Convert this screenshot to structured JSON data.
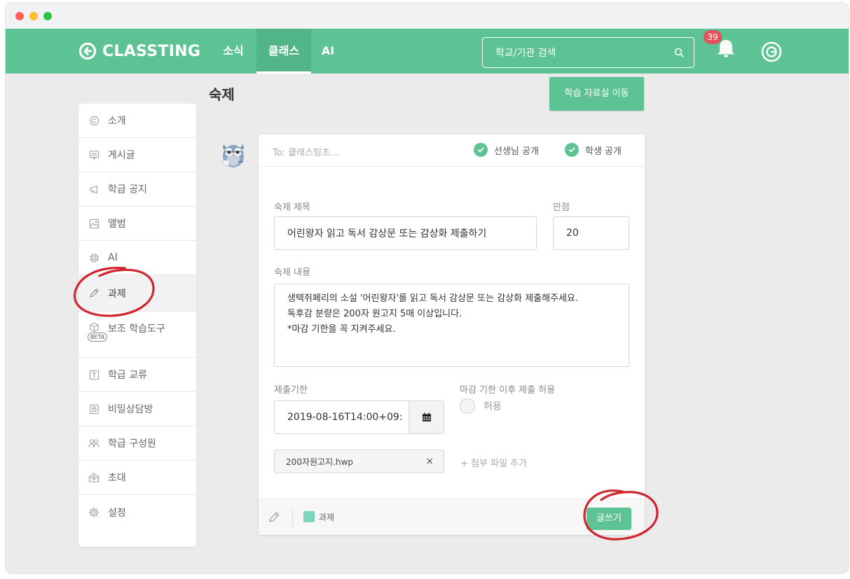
{
  "app": {
    "logo_text": "CLASSTING",
    "nav": [
      "소식",
      "클래스",
      "AI"
    ],
    "search_placeholder": "학교/기관 검색",
    "notification_count": "39"
  },
  "page": {
    "title": "숙제",
    "library_button": "학습 자료실 이동"
  },
  "sidebar": {
    "items": [
      {
        "label": "소개",
        "icon": "copyright-icon"
      },
      {
        "label": "게시글",
        "icon": "post-icon"
      },
      {
        "label": "학급 공지",
        "icon": "megaphone-icon"
      },
      {
        "label": "앨범",
        "icon": "image-icon"
      },
      {
        "label": "AI",
        "icon": "chip-icon"
      },
      {
        "label": "과제",
        "icon": "pencil-icon",
        "active": true
      },
      {
        "label": "보조 학습도구",
        "icon": "cube-icon",
        "badge": "BETA"
      },
      {
        "label": "학급 교류",
        "icon": "t-box-icon"
      },
      {
        "label": "비밀상담방",
        "icon": "lock-box-icon"
      },
      {
        "label": "학급 구성원",
        "icon": "members-icon"
      },
      {
        "label": "초대",
        "icon": "invite-icon"
      },
      {
        "label": "설정",
        "icon": "gear-icon"
      }
    ]
  },
  "form": {
    "to": "To: 클래스팅초…",
    "teacher_public": "선생님 공개",
    "student_public": "학생 공개",
    "title_label": "숙제 제목",
    "title_value": "어린왕자 읽고 독서 감상문 또는 감상화 제출하기",
    "score_label": "만점",
    "score_value": "20",
    "content_label": "숙제 내용",
    "content_lines": [
      "생텍쥐페리의 소설 '어린왕자'를 읽고 독서 감상문 또는 감상화 제출해주세요.",
      "독후감 분량은 200자 원고지 5매 이상입니다.",
      "*마감 기한을 꼭 지켜주세요."
    ],
    "deadline_label": "제출기한",
    "deadline_value": "2019-08-16T14:00+09:",
    "late_label": "마감 기한 이후 제출 허용",
    "late_option": "허용",
    "file_name": "200자원고지.hwp",
    "file_remove": "×",
    "add_file": "+ 첨부 파일 추가",
    "tag_label": "과제",
    "submit_label": "글쓰기"
  },
  "colors": {
    "brand": "#5ec394",
    "badge": "#e2525c",
    "annotation": "#d0242e",
    "tag": "#7fd3c1"
  }
}
